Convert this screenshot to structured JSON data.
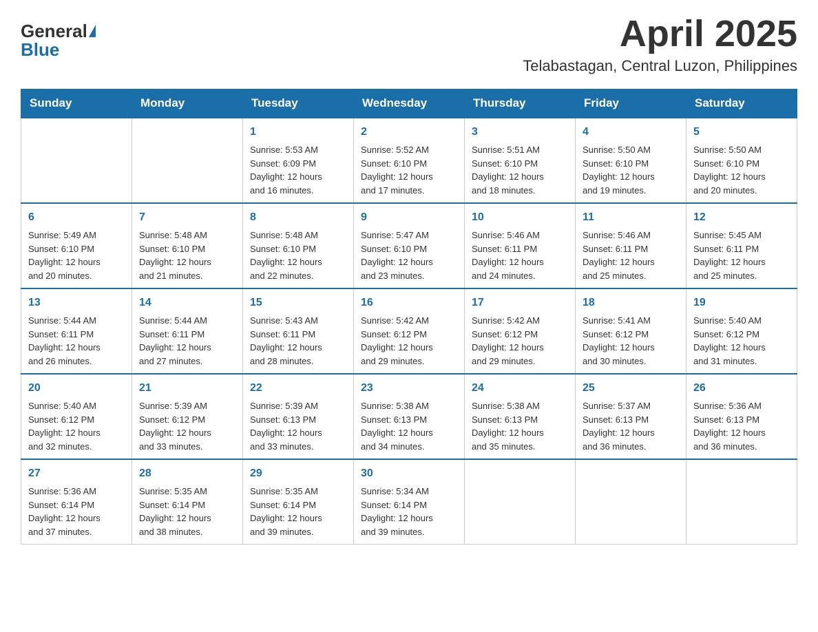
{
  "header": {
    "logo_general": "General",
    "logo_blue": "Blue",
    "month_title": "April 2025",
    "location": "Telabastagan, Central Luzon, Philippines"
  },
  "days_of_week": [
    "Sunday",
    "Monday",
    "Tuesday",
    "Wednesday",
    "Thursday",
    "Friday",
    "Saturday"
  ],
  "weeks": [
    [
      {
        "day": "",
        "info": ""
      },
      {
        "day": "",
        "info": ""
      },
      {
        "day": "1",
        "info": "Sunrise: 5:53 AM\nSunset: 6:09 PM\nDaylight: 12 hours\nand 16 minutes."
      },
      {
        "day": "2",
        "info": "Sunrise: 5:52 AM\nSunset: 6:10 PM\nDaylight: 12 hours\nand 17 minutes."
      },
      {
        "day": "3",
        "info": "Sunrise: 5:51 AM\nSunset: 6:10 PM\nDaylight: 12 hours\nand 18 minutes."
      },
      {
        "day": "4",
        "info": "Sunrise: 5:50 AM\nSunset: 6:10 PM\nDaylight: 12 hours\nand 19 minutes."
      },
      {
        "day": "5",
        "info": "Sunrise: 5:50 AM\nSunset: 6:10 PM\nDaylight: 12 hours\nand 20 minutes."
      }
    ],
    [
      {
        "day": "6",
        "info": "Sunrise: 5:49 AM\nSunset: 6:10 PM\nDaylight: 12 hours\nand 20 minutes."
      },
      {
        "day": "7",
        "info": "Sunrise: 5:48 AM\nSunset: 6:10 PM\nDaylight: 12 hours\nand 21 minutes."
      },
      {
        "day": "8",
        "info": "Sunrise: 5:48 AM\nSunset: 6:10 PM\nDaylight: 12 hours\nand 22 minutes."
      },
      {
        "day": "9",
        "info": "Sunrise: 5:47 AM\nSunset: 6:10 PM\nDaylight: 12 hours\nand 23 minutes."
      },
      {
        "day": "10",
        "info": "Sunrise: 5:46 AM\nSunset: 6:11 PM\nDaylight: 12 hours\nand 24 minutes."
      },
      {
        "day": "11",
        "info": "Sunrise: 5:46 AM\nSunset: 6:11 PM\nDaylight: 12 hours\nand 25 minutes."
      },
      {
        "day": "12",
        "info": "Sunrise: 5:45 AM\nSunset: 6:11 PM\nDaylight: 12 hours\nand 25 minutes."
      }
    ],
    [
      {
        "day": "13",
        "info": "Sunrise: 5:44 AM\nSunset: 6:11 PM\nDaylight: 12 hours\nand 26 minutes."
      },
      {
        "day": "14",
        "info": "Sunrise: 5:44 AM\nSunset: 6:11 PM\nDaylight: 12 hours\nand 27 minutes."
      },
      {
        "day": "15",
        "info": "Sunrise: 5:43 AM\nSunset: 6:11 PM\nDaylight: 12 hours\nand 28 minutes."
      },
      {
        "day": "16",
        "info": "Sunrise: 5:42 AM\nSunset: 6:12 PM\nDaylight: 12 hours\nand 29 minutes."
      },
      {
        "day": "17",
        "info": "Sunrise: 5:42 AM\nSunset: 6:12 PM\nDaylight: 12 hours\nand 29 minutes."
      },
      {
        "day": "18",
        "info": "Sunrise: 5:41 AM\nSunset: 6:12 PM\nDaylight: 12 hours\nand 30 minutes."
      },
      {
        "day": "19",
        "info": "Sunrise: 5:40 AM\nSunset: 6:12 PM\nDaylight: 12 hours\nand 31 minutes."
      }
    ],
    [
      {
        "day": "20",
        "info": "Sunrise: 5:40 AM\nSunset: 6:12 PM\nDaylight: 12 hours\nand 32 minutes."
      },
      {
        "day": "21",
        "info": "Sunrise: 5:39 AM\nSunset: 6:12 PM\nDaylight: 12 hours\nand 33 minutes."
      },
      {
        "day": "22",
        "info": "Sunrise: 5:39 AM\nSunset: 6:13 PM\nDaylight: 12 hours\nand 33 minutes."
      },
      {
        "day": "23",
        "info": "Sunrise: 5:38 AM\nSunset: 6:13 PM\nDaylight: 12 hours\nand 34 minutes."
      },
      {
        "day": "24",
        "info": "Sunrise: 5:38 AM\nSunset: 6:13 PM\nDaylight: 12 hours\nand 35 minutes."
      },
      {
        "day": "25",
        "info": "Sunrise: 5:37 AM\nSunset: 6:13 PM\nDaylight: 12 hours\nand 36 minutes."
      },
      {
        "day": "26",
        "info": "Sunrise: 5:36 AM\nSunset: 6:13 PM\nDaylight: 12 hours\nand 36 minutes."
      }
    ],
    [
      {
        "day": "27",
        "info": "Sunrise: 5:36 AM\nSunset: 6:14 PM\nDaylight: 12 hours\nand 37 minutes."
      },
      {
        "day": "28",
        "info": "Sunrise: 5:35 AM\nSunset: 6:14 PM\nDaylight: 12 hours\nand 38 minutes."
      },
      {
        "day": "29",
        "info": "Sunrise: 5:35 AM\nSunset: 6:14 PM\nDaylight: 12 hours\nand 39 minutes."
      },
      {
        "day": "30",
        "info": "Sunrise: 5:34 AM\nSunset: 6:14 PM\nDaylight: 12 hours\nand 39 minutes."
      },
      {
        "day": "",
        "info": ""
      },
      {
        "day": "",
        "info": ""
      },
      {
        "day": "",
        "info": ""
      }
    ]
  ]
}
